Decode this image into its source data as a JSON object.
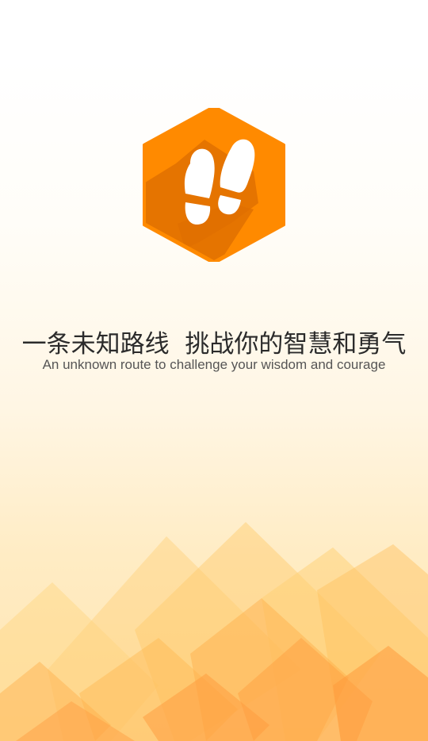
{
  "splash": {
    "logo_icon": "footprints-hexagon-icon",
    "tagline_cn": "一条未知路线  挑战你的智慧和勇气",
    "tagline_en": "An unknown route to challenge your wisdom and courage"
  },
  "colors": {
    "brand_orange": "#ff8a00",
    "brand_shadow": "#e07000",
    "mountain_light": "#ffd98a",
    "mountain_dark": "#ff9a3c"
  }
}
